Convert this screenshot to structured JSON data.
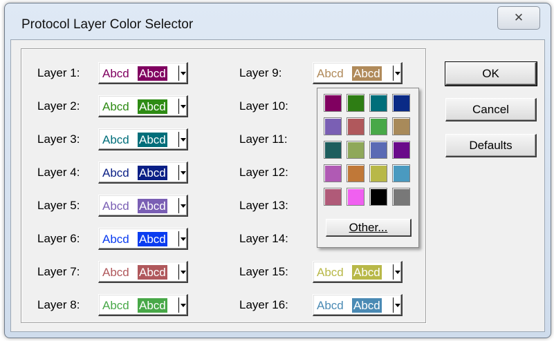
{
  "window": {
    "title": "Protocol Layer Color Selector",
    "close_glyph": "✕"
  },
  "sample_text": "Abcd",
  "layers_left": [
    {
      "label": "Layer 1:",
      "color": "#800060"
    },
    {
      "label": "Layer 2:",
      "color": "#2e8b14"
    },
    {
      "label": "Layer 3:",
      "color": "#006e7a"
    },
    {
      "label": "Layer 4:",
      "color": "#0a1f86"
    },
    {
      "label": "Layer 5:",
      "color": "#7a5fb4"
    },
    {
      "label": "Layer 6:",
      "color": "#0a3cf0"
    },
    {
      "label": "Layer 7:",
      "color": "#b0585c"
    },
    {
      "label": "Layer 8:",
      "color": "#48a848"
    }
  ],
  "layers_right": [
    {
      "label": "Layer 9:",
      "color": "#b08a5a"
    },
    {
      "label": "Layer 10:",
      "color": ""
    },
    {
      "label": "Layer 11:",
      "color": ""
    },
    {
      "label": "Layer 12:",
      "color": ""
    },
    {
      "label": "Layer 13:",
      "color": ""
    },
    {
      "label": "Layer 14:",
      "color": ""
    },
    {
      "label": "Layer 15:",
      "color": "#b8b848"
    },
    {
      "label": "Layer 16:",
      "color": "#4a8ab4"
    }
  ],
  "buttons": {
    "ok": "OK",
    "cancel": "Cancel",
    "defaults": "Defaults"
  },
  "palette": {
    "colors": [
      "#800060",
      "#2e7d14",
      "#006e7a",
      "#0a2a86",
      "#7a5fb4",
      "#b0585c",
      "#48a848",
      "#a88a5a",
      "#1e5e5e",
      "#8fa85a",
      "#5a6ab4",
      "#6a0a8a",
      "#b05ab4",
      "#c07838",
      "#b8b848",
      "#4a9ac0",
      "#b05a78",
      "#f060f0",
      "#000000",
      "#787878"
    ],
    "other_label": "Other..."
  }
}
